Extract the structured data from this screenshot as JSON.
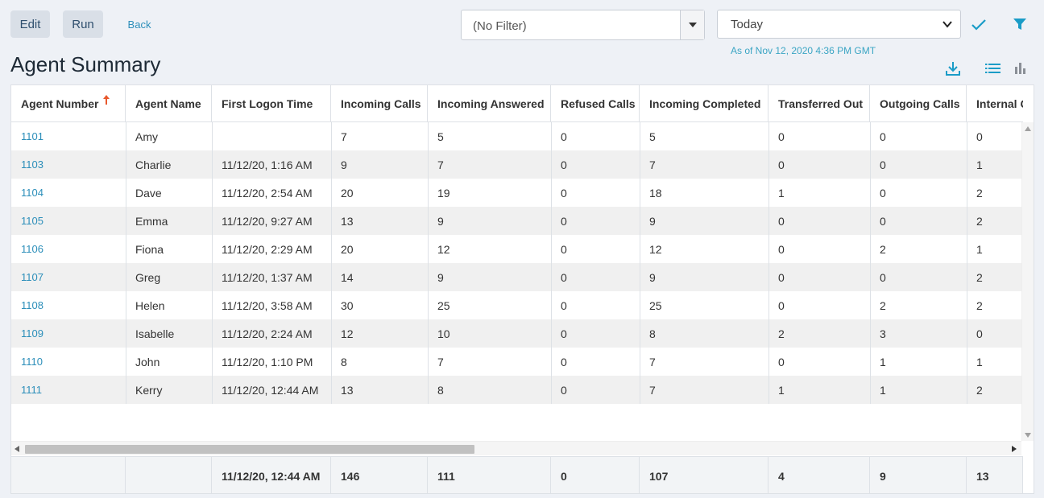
{
  "toolbar": {
    "edit_label": "Edit",
    "run_label": "Run",
    "back_label": "Back"
  },
  "filter": {
    "value": "(No Filter)"
  },
  "date_range": {
    "value": "Today",
    "as_of": "As of Nov 12, 2020 4:36 PM GMT"
  },
  "page": {
    "title": "Agent Summary"
  },
  "table": {
    "headers": [
      "Agent Number",
      "Agent Name",
      "First Logon Time",
      "Incoming Calls",
      "Incoming Answered",
      "Refused Calls",
      "Incoming Completed",
      "Transferred Out",
      "Outgoing Calls",
      "Internal Calls"
    ],
    "rows": [
      [
        "1101",
        "Amy",
        "",
        "7",
        "5",
        "0",
        "5",
        "0",
        "0",
        "0"
      ],
      [
        "1103",
        "Charlie",
        "11/12/20, 1:16 AM",
        "9",
        "7",
        "0",
        "7",
        "0",
        "0",
        "1"
      ],
      [
        "1104",
        "Dave",
        "11/12/20, 2:54 AM",
        "20",
        "19",
        "0",
        "18",
        "1",
        "0",
        "2"
      ],
      [
        "1105",
        "Emma",
        "11/12/20, 9:27 AM",
        "13",
        "9",
        "0",
        "9",
        "0",
        "0",
        "2"
      ],
      [
        "1106",
        "Fiona",
        "11/12/20, 2:29 AM",
        "20",
        "12",
        "0",
        "12",
        "0",
        "2",
        "1"
      ],
      [
        "1107",
        "Greg",
        "11/12/20, 1:37 AM",
        "14",
        "9",
        "0",
        "9",
        "0",
        "0",
        "2"
      ],
      [
        "1108",
        "Helen",
        "11/12/20, 3:58 AM",
        "30",
        "25",
        "0",
        "25",
        "0",
        "2",
        "2"
      ],
      [
        "1109",
        "Isabelle",
        "11/12/20, 2:24 AM",
        "12",
        "10",
        "0",
        "8",
        "2",
        "3",
        "0"
      ],
      [
        "1110",
        "John",
        "11/12/20, 1:10 PM",
        "8",
        "7",
        "0",
        "7",
        "0",
        "1",
        "1"
      ],
      [
        "1111",
        "Kerry",
        "11/12/20, 12:44 AM",
        "13",
        "8",
        "0",
        "7",
        "1",
        "1",
        "2"
      ]
    ],
    "totals": [
      "",
      "",
      "11/12/20, 12:44 AM",
      "146",
      "111",
      "0",
      "107",
      "4",
      "9",
      "13"
    ]
  },
  "colors": {
    "link": "#2d8fba",
    "accent": "#1a9cc7",
    "sort_arrow": "#e8582c"
  }
}
